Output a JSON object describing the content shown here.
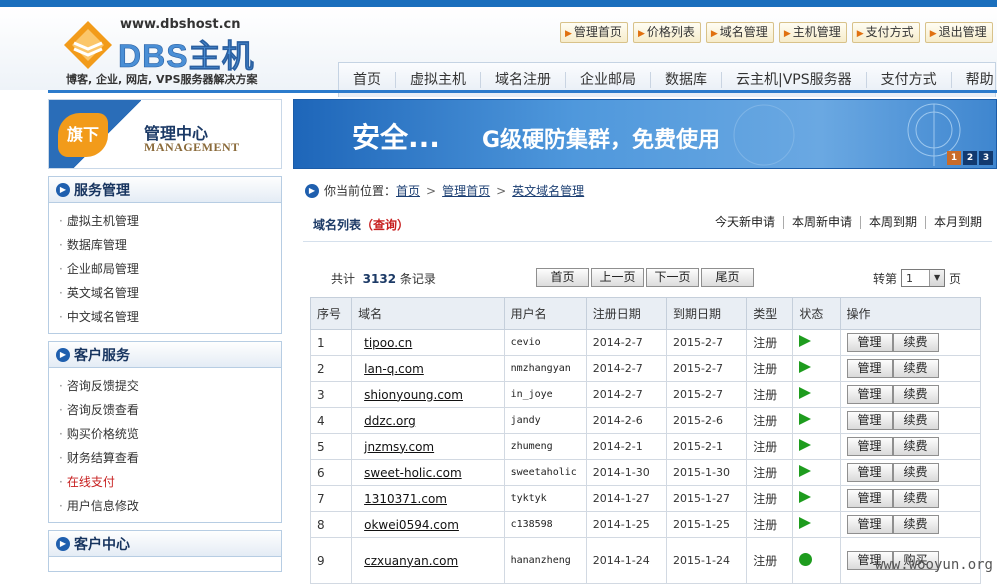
{
  "logo": {
    "url": "www.dbshost.cn",
    "name": "DBS主机",
    "slogan": "博客, 企业, 网店, VPS服务器解决方案"
  },
  "toplinks": [
    "管理首页",
    "价格列表",
    "域名管理",
    "主机管理",
    "支付方式",
    "退出管理"
  ],
  "nav": [
    "首页",
    "虚拟主机",
    "域名注册",
    "企业邮局",
    "数据库",
    "云主机|VPS服务器",
    "支付方式",
    "帮助"
  ],
  "mgmt": {
    "badge": "旗下",
    "title": "管理中心",
    "subtitle": "MANAGEMENT"
  },
  "sidebar": [
    {
      "title": "服务管理",
      "items": [
        "虚拟主机管理",
        "数据库管理",
        "企业邮局管理",
        "英文域名管理",
        "中文域名管理"
      ]
    },
    {
      "title": "客户服务",
      "items": [
        "咨询反馈提交",
        "咨询反馈查看",
        "购买价格统览",
        "财务结算查看",
        "在线支付",
        "用户信息修改"
      ]
    },
    {
      "title": "客户中心",
      "items": []
    }
  ],
  "banner": {
    "text1": "安全...",
    "text2": "G级硬防集群，免费使用",
    "pages": [
      "1",
      "2",
      "3"
    ]
  },
  "breadcrumb": {
    "prefix": "你当前位置：",
    "items": [
      "首页",
      "管理首页",
      "英文域名管理"
    ]
  },
  "list": {
    "title": "域名列表",
    "query": "（查询）",
    "filters": [
      "今天新申请",
      "本周新申请",
      "本周到期",
      "本月到期"
    ]
  },
  "pager": {
    "total_prefix": "共计",
    "total": "3132",
    "total_suffix": "条记录",
    "buttons": [
      "首页",
      "上一页",
      "下一页",
      "尾页"
    ],
    "jump_label": "转第",
    "page": "1",
    "page_suffix": "页"
  },
  "table": {
    "headers": [
      "序号",
      "域名",
      "用户名",
      "注册日期",
      "到期日期",
      "类型",
      "状态",
      "操作"
    ],
    "rows": [
      {
        "no": "1",
        "domain": "tipoo.cn",
        "user": "cevio",
        "reg": "2014-2-7",
        "exp": "2015-2-7",
        "type": "注册",
        "status": "active",
        "ops": [
          "管理",
          "续费"
        ]
      },
      {
        "no": "2",
        "domain": "lan-q.com",
        "user": "nmzhangyan",
        "reg": "2014-2-7",
        "exp": "2015-2-7",
        "type": "注册",
        "status": "active",
        "ops": [
          "管理",
          "续费"
        ]
      },
      {
        "no": "3",
        "domain": "shionyoung.com",
        "user": "in_joye",
        "reg": "2014-2-7",
        "exp": "2015-2-7",
        "type": "注册",
        "status": "active",
        "ops": [
          "管理",
          "续费"
        ]
      },
      {
        "no": "4",
        "domain": "ddzc.org",
        "user": "jandy",
        "reg": "2014-2-6",
        "exp": "2015-2-6",
        "type": "注册",
        "status": "active",
        "ops": [
          "管理",
          "续费"
        ]
      },
      {
        "no": "5",
        "domain": "jnzmsy.com",
        "user": "zhumeng",
        "reg": "2014-2-1",
        "exp": "2015-2-1",
        "type": "注册",
        "status": "active",
        "ops": [
          "管理",
          "续费"
        ]
      },
      {
        "no": "6",
        "domain": "sweet-holic.com",
        "user": "sweetaholic",
        "reg": "2014-1-30",
        "exp": "2015-1-30",
        "type": "注册",
        "status": "active",
        "ops": [
          "管理",
          "续费"
        ]
      },
      {
        "no": "7",
        "domain": "1310371.com",
        "user": "tyktyk",
        "reg": "2014-1-27",
        "exp": "2015-1-27",
        "type": "注册",
        "status": "active",
        "ops": [
          "管理",
          "续费"
        ]
      },
      {
        "no": "8",
        "domain": "okwei0594.com",
        "user": "c138598",
        "reg": "2014-1-25",
        "exp": "2015-1-25",
        "type": "注册",
        "status": "active",
        "ops": [
          "管理",
          "续费"
        ]
      },
      {
        "no": "9",
        "domain": "czxuanyan.com",
        "user": "hananzheng",
        "reg": "2014-1-24",
        "exp": "2015-1-24",
        "type": "注册",
        "status": "pending",
        "ops": [
          "管理",
          "购买"
        ]
      }
    ]
  },
  "watermark": "www.wooyun.org"
}
